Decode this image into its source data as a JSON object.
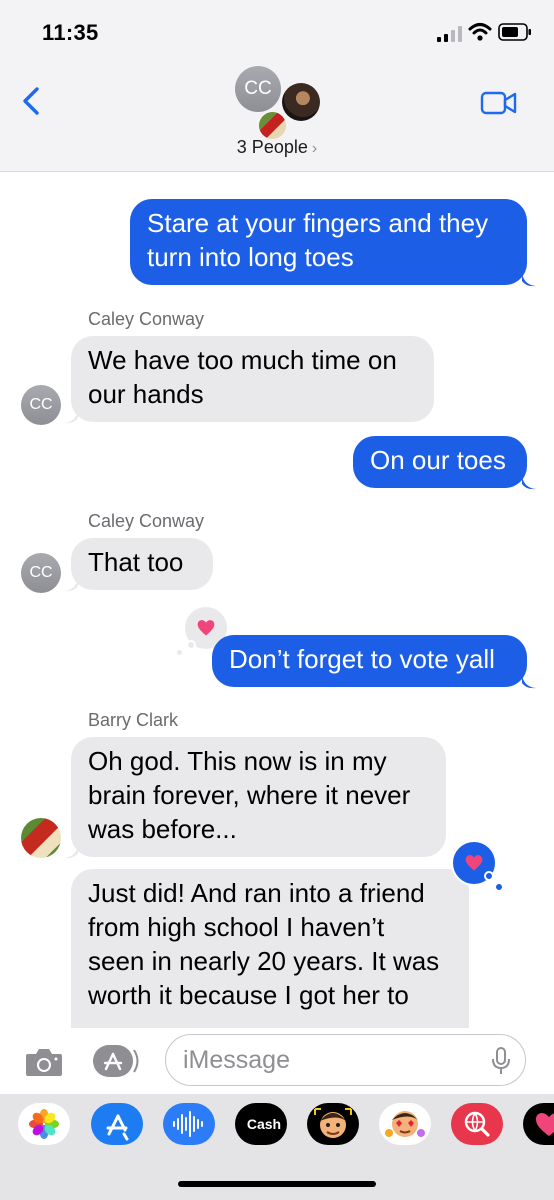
{
  "status_bar": {
    "time": "11:35"
  },
  "header": {
    "avatar_initials": "CC",
    "group_label": "3 People",
    "group_chevron": "›"
  },
  "messages": [
    {
      "direction": "outgoing",
      "text_line1": "Stare at your fingers and they",
      "text_line2": "turn into long toes"
    },
    {
      "direction": "incoming",
      "sender": "Caley Conway",
      "avatar": "CC",
      "text_line1": "We have too much time on",
      "text_line2": "our hands"
    },
    {
      "direction": "outgoing",
      "text_line1": "On our toes"
    },
    {
      "direction": "incoming",
      "sender": "Caley Conway",
      "avatar": "CC",
      "text_line1": "That too"
    },
    {
      "direction": "outgoing",
      "text_line1": "Don’t forget to vote yall",
      "tapback": "heart"
    },
    {
      "direction": "incoming",
      "sender": "Barry Clark",
      "text_line1": "Oh god. This now is in my",
      "text_line2": "brain forever, where it never",
      "text_line3": "was before..."
    },
    {
      "direction": "incoming",
      "text_line1": "Just did! And ran into a friend",
      "text_line2": "from high school I haven’t",
      "text_line3": "seen in nearly 20 years. It was",
      "text_line4": "worth it because I got her to",
      "tapback": "heart"
    }
  ],
  "input": {
    "placeholder": "iMessage"
  },
  "app_drawer": {
    "apps": [
      "photos-icon",
      "app-store-icon",
      "audio-message-icon",
      "apple-cash-icon",
      "memoji-icon",
      "memoji-stickers-icon",
      "search-images-icon",
      "digital-touch-icon"
    ],
    "cash_label": "Cash"
  },
  "colors": {
    "outgoing_bubble": "#1d5ee6",
    "incoming_bubble": "#e9e9eb",
    "heart": "#f0457a"
  }
}
